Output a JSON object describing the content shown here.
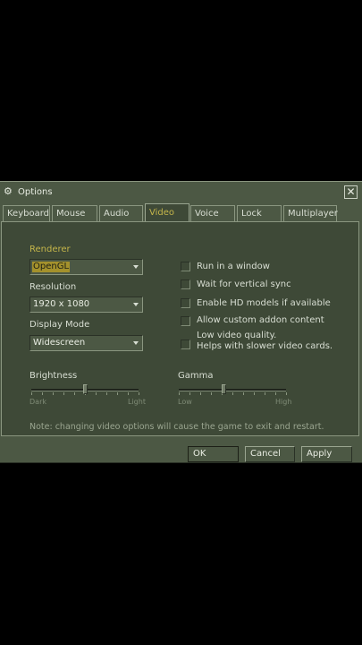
{
  "window": {
    "title": "Options",
    "close_label": "✕"
  },
  "tabs": [
    {
      "label": "Keyboard"
    },
    {
      "label": "Mouse"
    },
    {
      "label": "Audio"
    },
    {
      "label": "Video",
      "active": true
    },
    {
      "label": "Voice"
    },
    {
      "label": "Lock"
    },
    {
      "label": "Multiplayer"
    }
  ],
  "video": {
    "renderer_label": "Renderer",
    "renderer_value": "OpenGL",
    "resolution_label": "Resolution",
    "resolution_value": "1920 x 1080",
    "display_mode_label": "Display Mode",
    "display_mode_value": "Widescreen",
    "options": [
      {
        "label": "Run in a window",
        "checked": false
      },
      {
        "label": "Wait for vertical sync",
        "checked": false
      },
      {
        "label": "Enable HD models if available",
        "checked": false
      },
      {
        "label": "Allow custom addon content",
        "checked": false
      },
      {
        "label_line1": "Low video quality.",
        "label_line2": "Helps with slower video cards.",
        "checked": false
      }
    ],
    "brightness": {
      "label": "Brightness",
      "min_label": "Dark",
      "max_label": "Light",
      "value": 0.5
    },
    "gamma": {
      "label": "Gamma",
      "min_label": "Low",
      "max_label": "High",
      "value": 0.42
    },
    "note": "Note: changing video options will cause the game to exit and restart."
  },
  "buttons": {
    "ok": "OK",
    "cancel": "Cancel",
    "apply": "Apply"
  },
  "colors": {
    "accent": "#c4b54a",
    "panel": "#3e4937",
    "frame": "#4c5844"
  },
  "icons": {
    "title": "steam-icon",
    "close": "close-icon",
    "dropdown": "chevron-down-icon"
  }
}
